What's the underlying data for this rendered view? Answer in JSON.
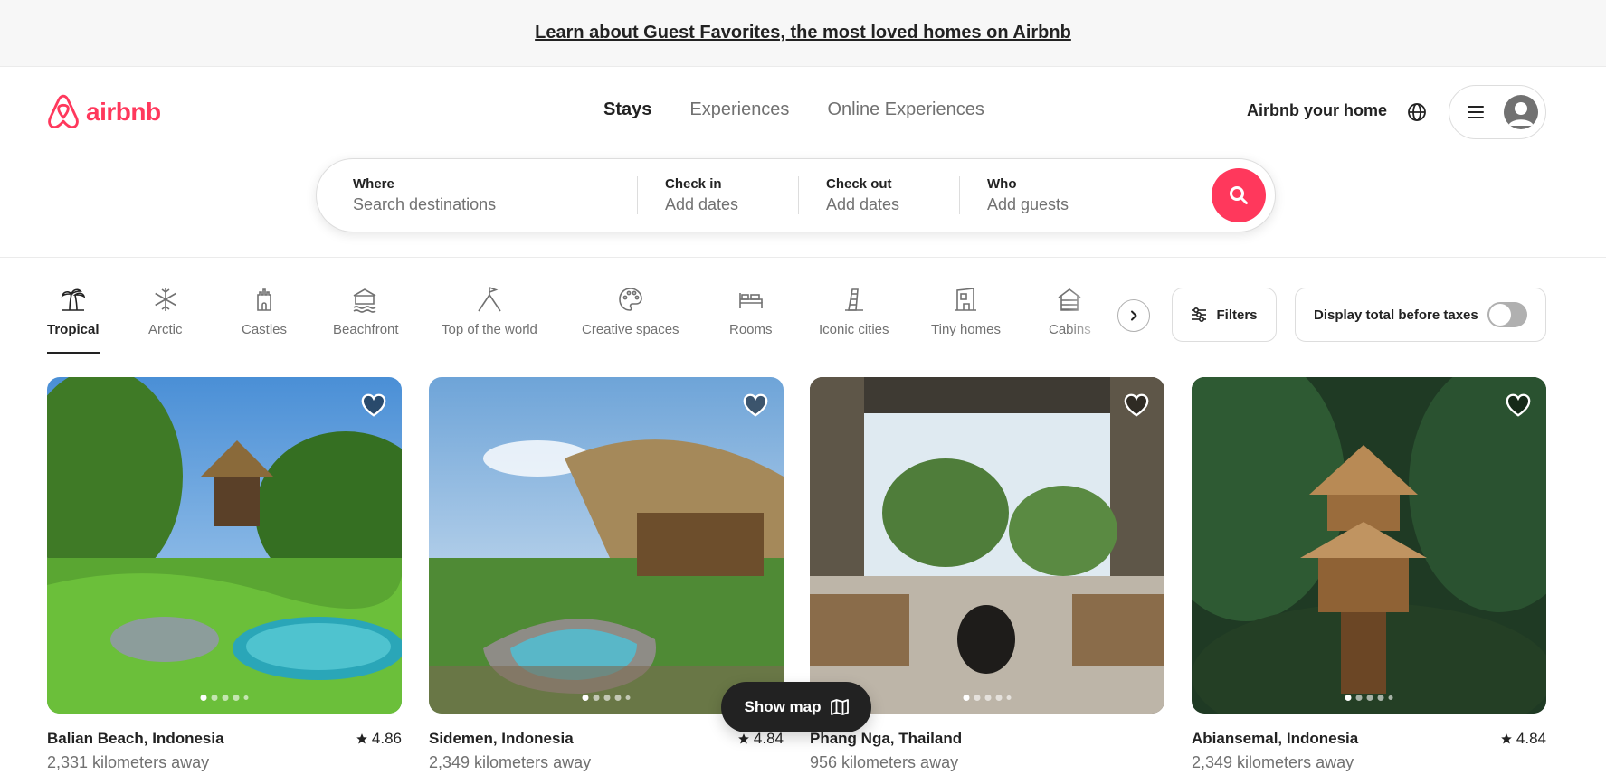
{
  "banner": {
    "text": "Learn about Guest Favorites, the most loved homes on Airbnb"
  },
  "header": {
    "logo_text": "airbnb",
    "brand_color": "#ff385c",
    "nav": [
      {
        "label": "Stays",
        "active": true
      },
      {
        "label": "Experiences",
        "active": false
      },
      {
        "label": "Online Experiences",
        "active": false
      }
    ],
    "host_link": "Airbnb your home",
    "icons": [
      "globe-icon",
      "hamburger-menu-icon",
      "user-avatar-icon"
    ]
  },
  "search": {
    "where": {
      "label": "Where",
      "placeholder": "Search destinations"
    },
    "checkin": {
      "label": "Check in",
      "placeholder": "Add dates"
    },
    "checkout": {
      "label": "Check out",
      "placeholder": "Add dates"
    },
    "who": {
      "label": "Who",
      "placeholder": "Add guests"
    }
  },
  "categories": [
    {
      "label": "Tropical",
      "icon": "palm-tree-icon",
      "active": true
    },
    {
      "label": "Arctic",
      "icon": "snowflake-icon",
      "active": false
    },
    {
      "label": "Castles",
      "icon": "castle-icon",
      "active": false
    },
    {
      "label": "Beachfront",
      "icon": "beach-icon",
      "active": false
    },
    {
      "label": "Top of the world",
      "icon": "mountain-flag-icon",
      "active": false
    },
    {
      "label": "Creative spaces",
      "icon": "palette-icon",
      "active": false
    },
    {
      "label": "Rooms",
      "icon": "bed-icon",
      "active": false
    },
    {
      "label": "Iconic cities",
      "icon": "leaning-tower-icon",
      "active": false
    },
    {
      "label": "Tiny homes",
      "icon": "tiny-home-icon",
      "active": false
    },
    {
      "label": "Cabins",
      "icon": "cabin-icon",
      "active": false
    }
  ],
  "filters": {
    "label": "Filters"
  },
  "taxes_toggle": {
    "label": "Display total before taxes",
    "on": false
  },
  "listings": [
    {
      "location": "Balian Beach, Indonesia",
      "rating": "4.86",
      "distance": "2,331 kilometers away",
      "image": "treehouse-jungle-pool-photo"
    },
    {
      "location": "Sidemen, Indonesia",
      "rating": "4.84",
      "distance": "2,349 kilometers away",
      "image": "bamboo-house-pool-photo"
    },
    {
      "location": "Phang Nga, Thailand",
      "rating": "",
      "distance": "956 kilometers away",
      "image": "open-living-room-palms-photo"
    },
    {
      "location": "Abiansemal, Indonesia",
      "rating": "4.84",
      "distance": "2,349 kilometers away",
      "image": "bamboo-treehouse-forest-photo"
    }
  ],
  "show_map": {
    "label": "Show map",
    "icon": "map-icon"
  }
}
